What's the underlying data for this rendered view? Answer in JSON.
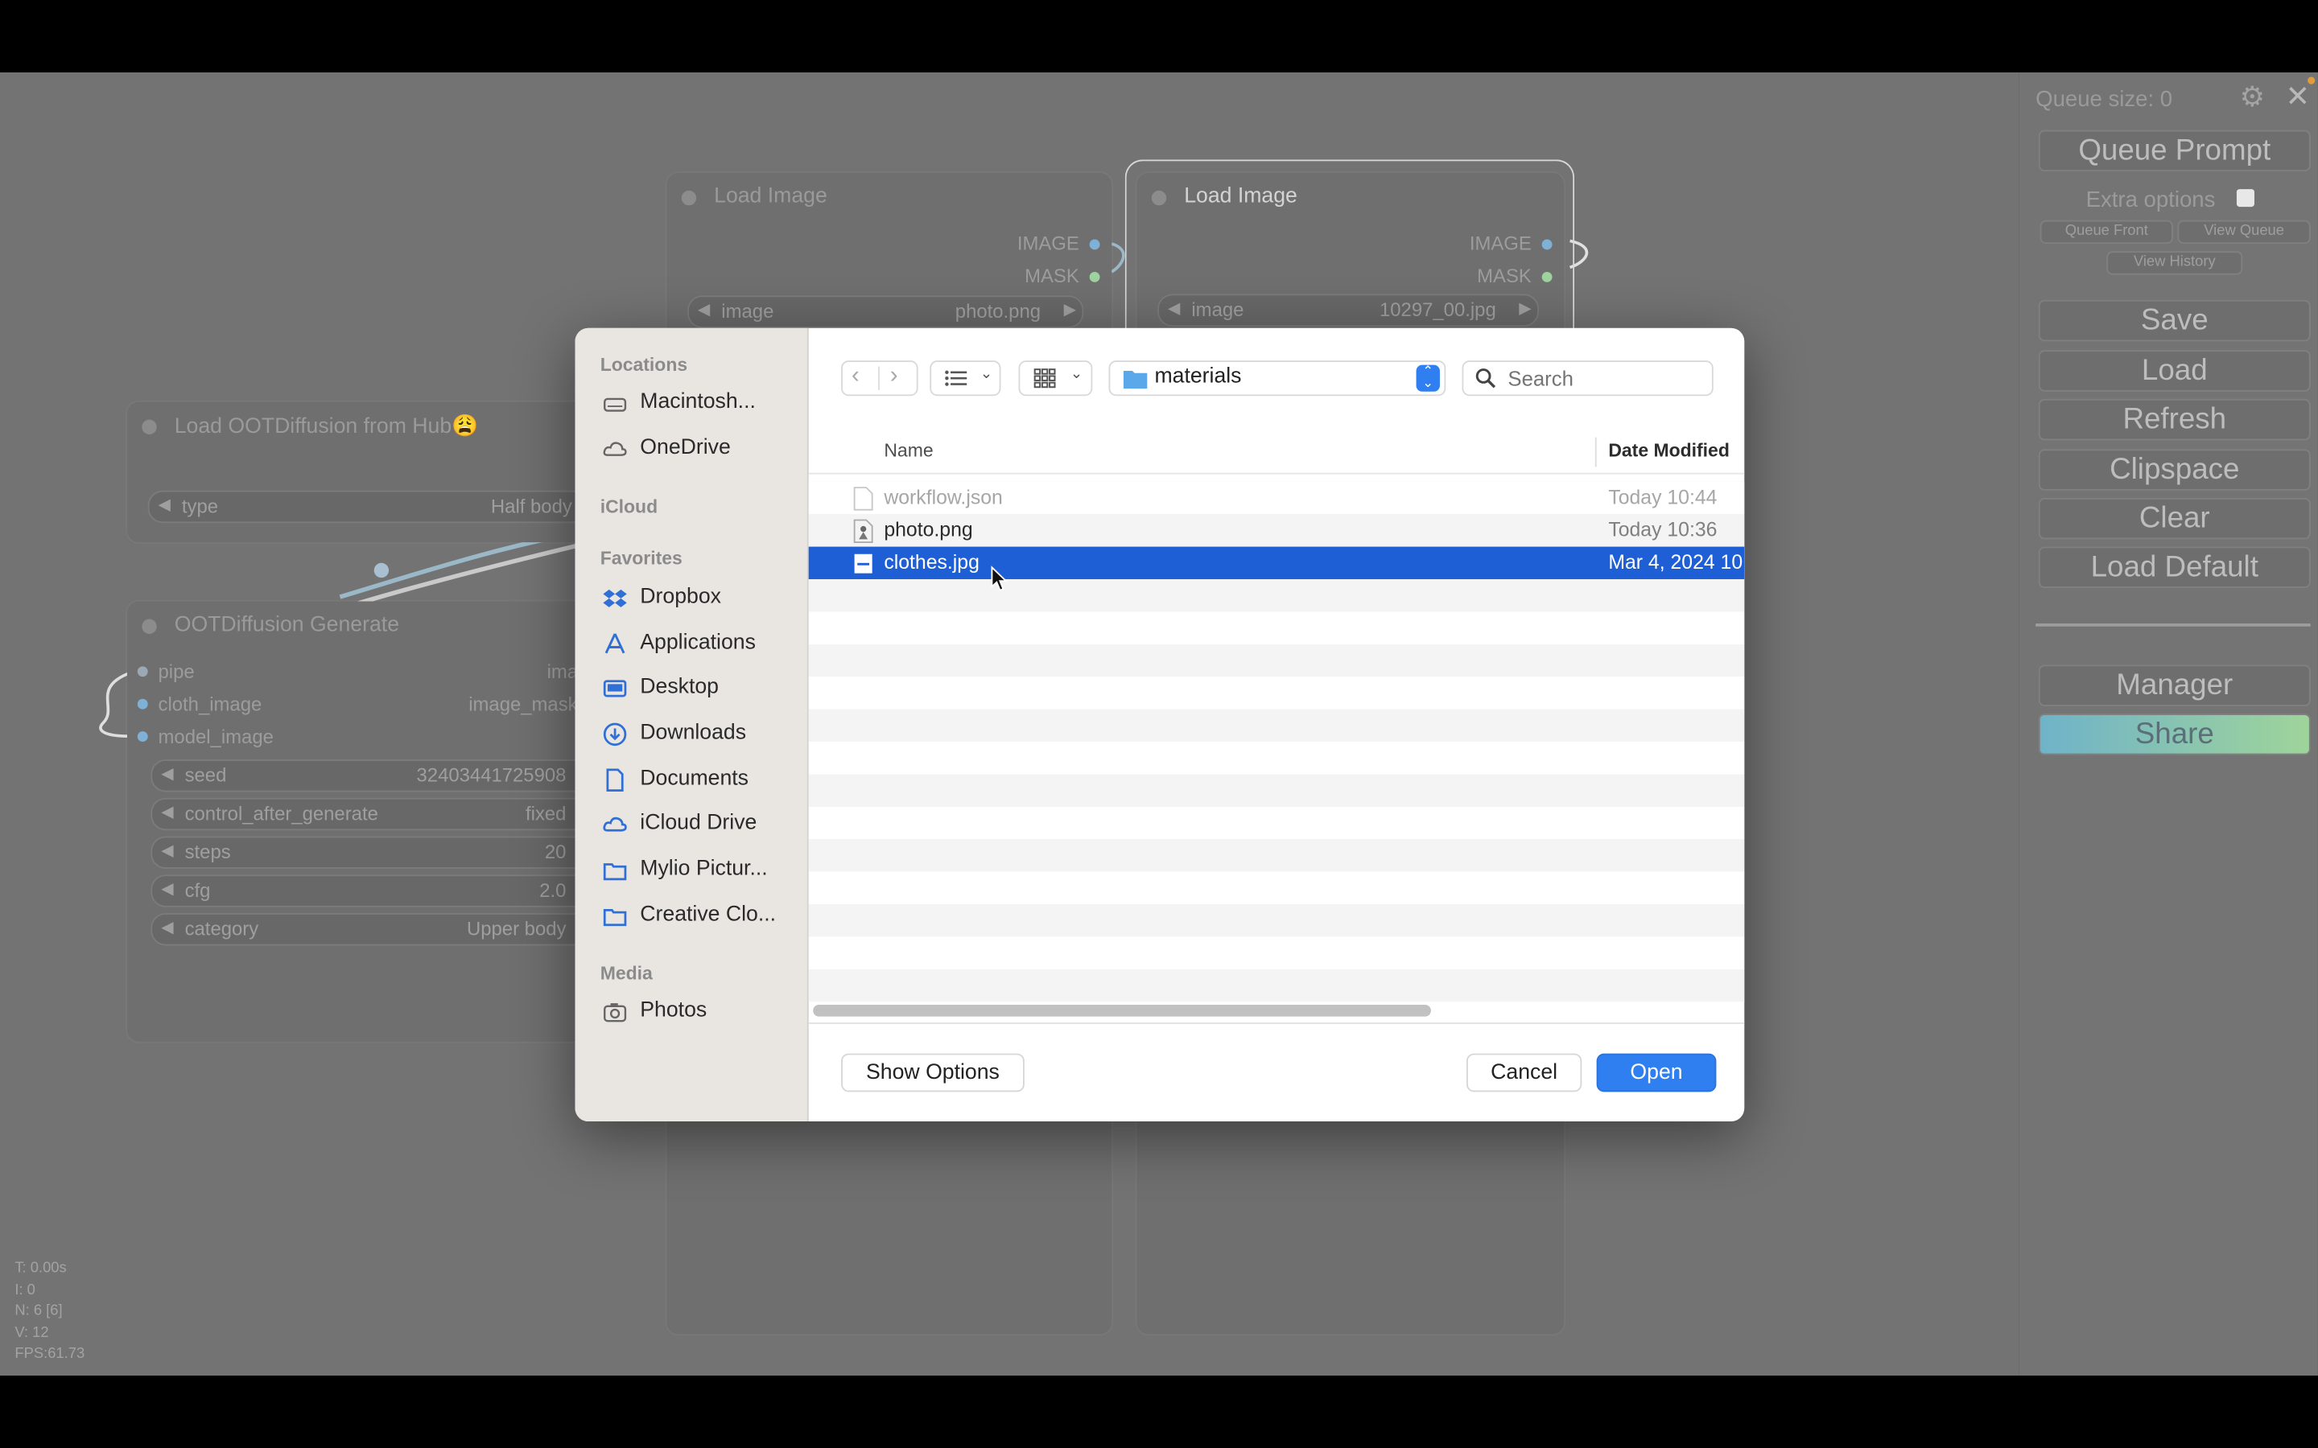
{
  "canvas": {
    "nodes": {
      "load_image_1": {
        "title": "Load Image",
        "outputs": [
          "IMAGE",
          "MASK"
        ],
        "widget_label": "image",
        "widget_value": "photo.png"
      },
      "load_image_2": {
        "title": "Load Image",
        "outputs": [
          "IMAGE",
          "MASK"
        ],
        "widget_label": "image",
        "widget_value": "10297_00.jpg"
      },
      "load_hub": {
        "title": "Load OOTDiffusion from Hub😩",
        "widget_label": "type",
        "widget_value": "Half body"
      },
      "generate": {
        "title": "OOTDiffusion Generate",
        "inputs": [
          "pipe",
          "cloth_image",
          "model_image"
        ],
        "outputs": [
          "ima",
          "image_mask"
        ],
        "widgets": [
          {
            "label": "seed",
            "value": "32403441725908"
          },
          {
            "label": "control_after_generate",
            "value": "fixed"
          },
          {
            "label": "steps",
            "value": "20"
          },
          {
            "label": "cfg",
            "value": "2.0"
          },
          {
            "label": "category",
            "value": "Upper body"
          }
        ]
      }
    },
    "stats": [
      "T: 0.00s",
      "I: 0",
      "N: 6 [6]",
      "V: 12",
      "FPS:61.73"
    ]
  },
  "panel": {
    "queue_size": "Queue size: 0",
    "queue_prompt": "Queue Prompt",
    "extra_options": "Extra options",
    "queue_front": "Queue Front",
    "view_queue": "View Queue",
    "view_history": "View History",
    "buttons": [
      "Save",
      "Load",
      "Refresh",
      "Clipspace",
      "Clear",
      "Load Default"
    ],
    "manager": "Manager",
    "share": "Share"
  },
  "dialog": {
    "sidebar": {
      "locations_header": "Locations",
      "locations": [
        "Macintosh...",
        "OneDrive"
      ],
      "icloud_header": "iCloud",
      "favorites_header": "Favorites",
      "favorites": [
        "Dropbox",
        "Applications",
        "Desktop",
        "Downloads",
        "Documents",
        "iCloud Drive",
        "Mylio Pictur...",
        "Creative Clo..."
      ],
      "media_header": "Media",
      "media": [
        "Photos"
      ]
    },
    "toolbar": {
      "folder": "materials",
      "search_placeholder": "Search"
    },
    "columns": {
      "name": "Name",
      "date": "Date Modified"
    },
    "files": [
      {
        "name": "workflow.json",
        "date": "Today 10:44",
        "dimmed": true
      },
      {
        "name": "photo.png",
        "date": "Today 10:36",
        "dimmed": false
      },
      {
        "name": "clothes.jpg",
        "date": "Mar 4, 2024 10",
        "selected": true
      }
    ],
    "show_options": "Show Options",
    "cancel": "Cancel",
    "open": "Open",
    "colors": {
      "selection": "#1f5fd6",
      "accent": "#2f7ff0"
    }
  }
}
